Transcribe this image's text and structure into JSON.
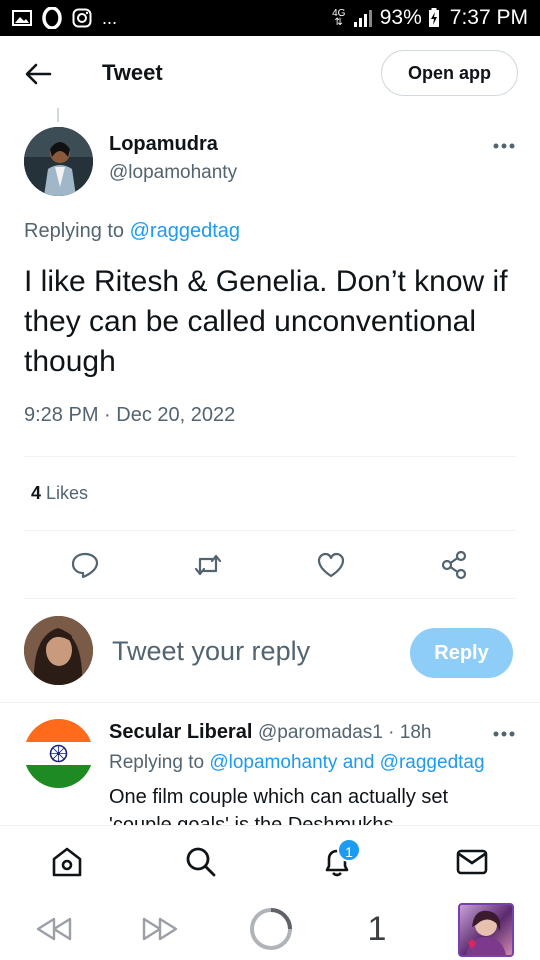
{
  "status_bar": {
    "network": "4G",
    "battery": "93%",
    "time": "7:37 PM",
    "more": "..."
  },
  "header": {
    "title": "Tweet",
    "open_app_label": "Open app"
  },
  "tweet": {
    "author_name": "Lopamudra",
    "author_handle": "@lopamohanty",
    "replying_prefix": "Replying to",
    "replying_to": "@raggedtag",
    "text": "I like Ritesh & Genelia. Don’t know if they can be called unconventional though",
    "timestamp": "9:28 PM · Dec 20, 2022",
    "likes_count": "4",
    "likes_label": "Likes"
  },
  "compose": {
    "placeholder": "Tweet your reply",
    "reply_label": "Reply"
  },
  "reply": {
    "name": "Secular Liberal",
    "handle_time": "@paromadas1 · 18h",
    "replying_prefix": "Replying to",
    "replying_to": "@lopamohanty and @raggedtag",
    "text": "One film couple which can actually set 'couple goals' is the Deshmukhs"
  },
  "bottom_nav": {
    "notifications_badge": "1"
  },
  "browser_bar": {
    "tab_count": "1"
  },
  "colors": {
    "accent": "#1d9bf0",
    "reply_button_disabled": "#8ecdf8",
    "secondary_text": "#536471"
  }
}
